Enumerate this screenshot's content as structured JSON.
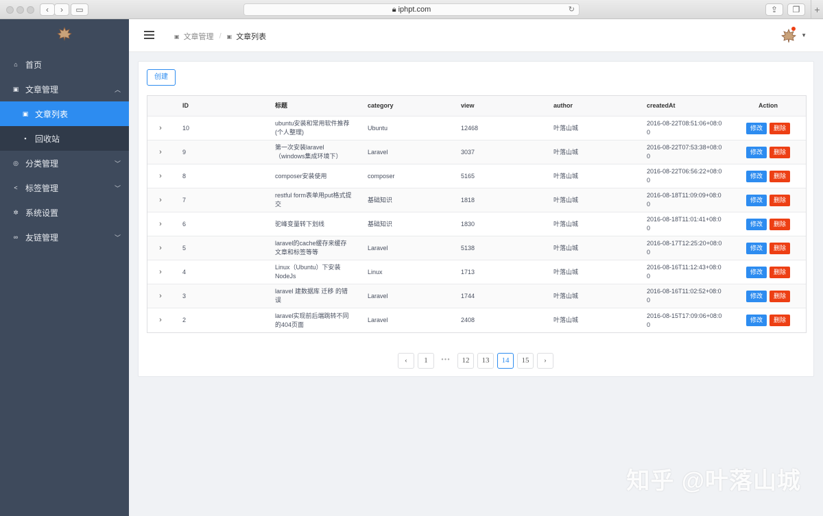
{
  "browser": {
    "url": "iphpt.com"
  },
  "sidebar": {
    "items": [
      {
        "label": "首页",
        "icon": "home-icon"
      },
      {
        "label": "文章管理",
        "icon": "book-icon",
        "expanded": true,
        "children": [
          {
            "label": "文章列表",
            "icon": "book-icon",
            "active": true
          },
          {
            "label": "回收站",
            "icon": "trash-icon"
          }
        ]
      },
      {
        "label": "分类管理",
        "icon": "target-icon"
      },
      {
        "label": "标签管理",
        "icon": "share-icon"
      },
      {
        "label": "系统设置",
        "icon": "gear-icon"
      },
      {
        "label": "友链管理",
        "icon": "link-icon"
      }
    ]
  },
  "header": {
    "breadcrumb": [
      "文章管理",
      "文章列表"
    ]
  },
  "main": {
    "create_label": "创建",
    "columns": [
      "ID",
      "标题",
      "category",
      "view",
      "author",
      "createdAt",
      "Action"
    ],
    "edit_label": "修改",
    "delete_label": "删除",
    "rows": [
      {
        "id": "10",
        "title": "ubuntu安装和常用软件推荐(个人整理)",
        "category": "Ubuntu",
        "view": "12468",
        "author": "叶落山城",
        "createdAt": "2016-08-22T08:51:06+08:00"
      },
      {
        "id": "9",
        "title": "第一次安装laravel（windows集成环境下）",
        "category": "Laravel",
        "view": "3037",
        "author": "叶落山城",
        "createdAt": "2016-08-22T07:53:38+08:00"
      },
      {
        "id": "8",
        "title": "composer安装使用",
        "category": "composer",
        "view": "5165",
        "author": "叶落山城",
        "createdAt": "2016-08-22T06:56:22+08:00"
      },
      {
        "id": "7",
        "title": "restful form表单用put格式提交",
        "category": "基础知识",
        "view": "1818",
        "author": "叶落山城",
        "createdAt": "2016-08-18T11:09:09+08:00"
      },
      {
        "id": "6",
        "title": "驼峰变量转下划线",
        "category": "基础知识",
        "view": "1830",
        "author": "叶落山城",
        "createdAt": "2016-08-18T11:01:41+08:00"
      },
      {
        "id": "5",
        "title": "laravel的cache缓存来缓存文章和标签等等",
        "category": "Laravel",
        "view": "5138",
        "author": "叶落山城",
        "createdAt": "2016-08-17T12:25:20+08:00"
      },
      {
        "id": "4",
        "title": "Linux（Ubuntu）下安装NodeJs",
        "category": "Linux",
        "view": "1713",
        "author": "叶落山城",
        "createdAt": "2016-08-16T11:12:43+08:00"
      },
      {
        "id": "3",
        "title": "laravel 建数据库 迁移 的错误",
        "category": "Laravel",
        "view": "1744",
        "author": "叶落山城",
        "createdAt": "2016-08-16T11:02:52+08:00"
      },
      {
        "id": "2",
        "title": "laravel实现前后端跳转不同的404页面",
        "category": "Laravel",
        "view": "2408",
        "author": "叶落山城",
        "createdAt": "2016-08-15T17:09:06+08:00"
      }
    ],
    "pagination": {
      "prev": "‹",
      "next": "›",
      "pages": [
        "1",
        "•••",
        "12",
        "13",
        "14",
        "15"
      ],
      "current": "14"
    }
  },
  "watermark": "知乎 @叶落山城",
  "colors": {
    "primary": "#2d8cf0",
    "danger": "#ed3f14",
    "sidebar": "#3e4a5c",
    "sidebar_sub": "#303a49"
  }
}
